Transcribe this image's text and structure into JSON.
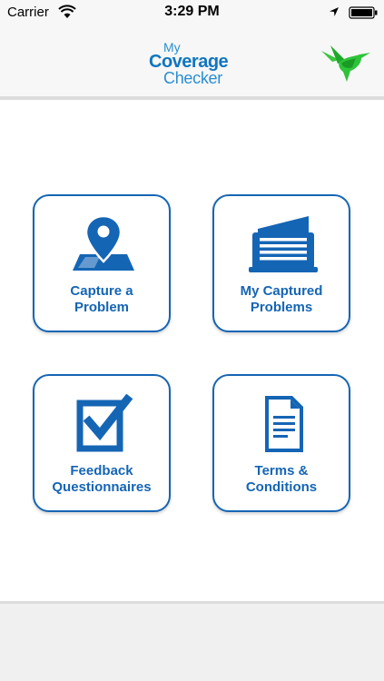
{
  "status_bar": {
    "carrier": "Carrier",
    "time": "3:29 PM",
    "icons": [
      "wifi-icon",
      "location-arrow-icon",
      "battery-icon"
    ]
  },
  "header": {
    "logo_line1": "My",
    "logo_line2": "Coverage",
    "logo_line3": "Checker",
    "brand_icon": "hummingbird-icon"
  },
  "menu": {
    "tiles": [
      {
        "label_line1": "Capture a",
        "label_line2": "Problem",
        "icon": "map-pin-icon"
      },
      {
        "label_line1": "My Captured",
        "label_line2": "Problems",
        "icon": "document-stack-icon"
      },
      {
        "label_line1": "Feedback",
        "label_line2": "Questionnaires",
        "icon": "checkbox-icon"
      },
      {
        "label_line1": "Terms &",
        "label_line2": "Conditions",
        "icon": "document-icon"
      }
    ]
  },
  "colors": {
    "accent": "#1565b5",
    "logo_blue": "#1e88c8",
    "brand_green": "#2ec43a",
    "bar_background": "#f7f7f7"
  }
}
